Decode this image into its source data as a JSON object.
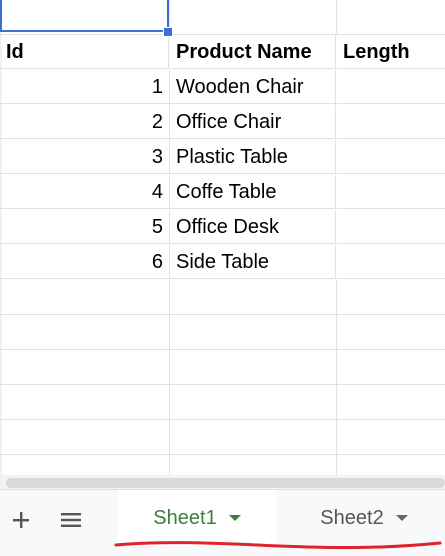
{
  "sheet": {
    "headers": [
      "Id",
      "Product Name",
      "Length"
    ],
    "rows": [
      {
        "id": "1",
        "name": "Wooden Chair",
        "length": ""
      },
      {
        "id": "2",
        "name": "Office Chair",
        "length": ""
      },
      {
        "id": "3",
        "name": "Plastic Table",
        "length": ""
      },
      {
        "id": "4",
        "name": "Coffe Table",
        "length": ""
      },
      {
        "id": "5",
        "name": "Office Desk",
        "length": ""
      },
      {
        "id": "6",
        "name": "Side Table",
        "length": ""
      }
    ]
  },
  "tabs": [
    {
      "label": "Sheet1",
      "active": true
    },
    {
      "label": "Sheet2",
      "active": false
    }
  ],
  "icons": {
    "add": "plus-icon",
    "list": "list-icon",
    "dropdown": "caret-down-icon"
  },
  "colors": {
    "selection": "#3b6fd6",
    "active_tab": "#3e7d3c",
    "annotation": "#e0232b"
  }
}
